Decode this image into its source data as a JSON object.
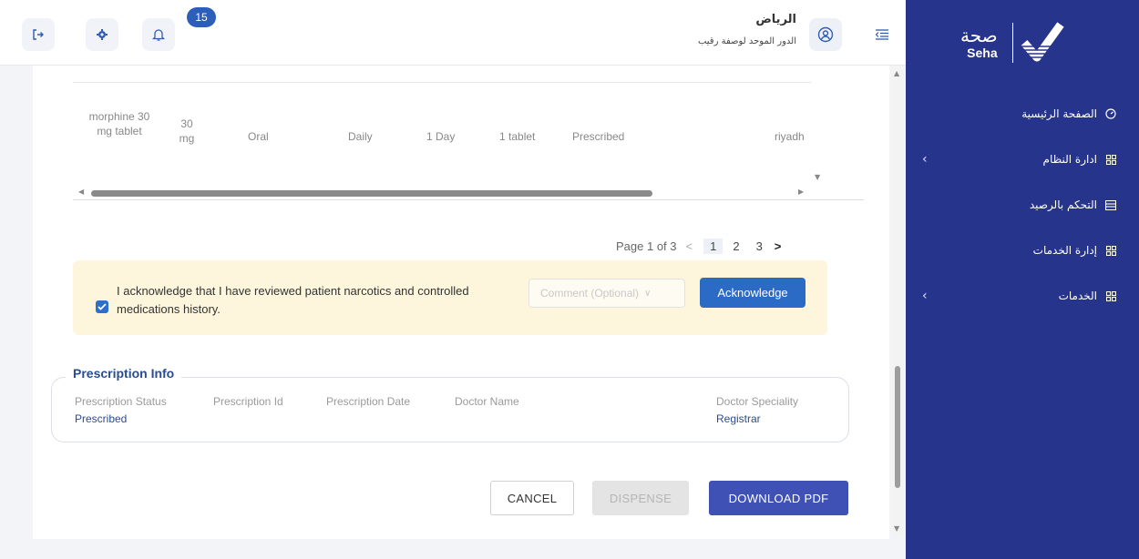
{
  "header": {
    "notification_count": "15",
    "user_city": "الرياض",
    "user_role": "الدور الموحد لوصفة رقيب"
  },
  "sidebar": {
    "logo_ar": "صحة",
    "logo_en": "Seha",
    "items": [
      {
        "label": "الصفحة الرئيسية",
        "icon": "dashboard-icon",
        "has_submenu": false
      },
      {
        "label": "ادارة النظام",
        "icon": "grid-icon",
        "has_submenu": true
      },
      {
        "label": "التحكم بالرصيد",
        "icon": "wallet-icon",
        "has_submenu": false
      },
      {
        "label": "إدارة الخدمات",
        "icon": "grid-icon",
        "has_submenu": false
      },
      {
        "label": "الخدمات",
        "icon": "grid-icon",
        "has_submenu": true
      }
    ]
  },
  "table": {
    "row": {
      "medicine": "morphine 30 mg tablet",
      "dose": "30 mg",
      "route": "Oral",
      "frequency": "Daily",
      "duration": "1 Day",
      "quantity": "1 tablet",
      "status": "Prescribed",
      "location": "riyadh"
    }
  },
  "pagination": {
    "summary": "Page 1 of 3",
    "prev": "<",
    "pages": [
      "1",
      "2",
      "3"
    ],
    "next": ">",
    "current": 1
  },
  "acknowledge": {
    "checked": true,
    "text": "I acknowledge that I have reviewed patient narcotics and controlled medications history.",
    "comment_placeholder": "Comment (Optional)",
    "button_label": "Acknowledge"
  },
  "prescription_info": {
    "title": "Prescription Info",
    "fields": [
      {
        "label": "Prescription Status",
        "value": "Prescribed"
      },
      {
        "label": "Prescription Id",
        "value": ""
      },
      {
        "label": "Prescription Date",
        "value": ""
      },
      {
        "label": "Doctor Name",
        "value": ""
      },
      {
        "label": "Doctor Speciality",
        "value": "Registrar"
      }
    ]
  },
  "actions": {
    "cancel": "CANCEL",
    "dispense": "DISPENSE",
    "download_pdf": "DOWNLOAD PDF"
  },
  "colors": {
    "sidebar": "#27348b",
    "primary": "#3f51b5",
    "accent_blue": "#2b6bc5",
    "ack_background": "#fdf6dd"
  }
}
